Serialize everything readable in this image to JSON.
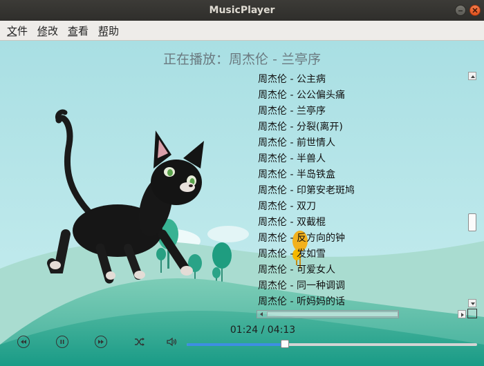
{
  "window": {
    "title": "MusicPlayer"
  },
  "menu": [
    {
      "label": "文件",
      "name": "menu-file"
    },
    {
      "label": "修改",
      "name": "menu-edit"
    },
    {
      "label": "查看",
      "name": "menu-view"
    },
    {
      "label": "帮助",
      "name": "menu-help"
    }
  ],
  "now_playing": "正在播放：周杰伦 - 兰亭序",
  "playlist": [
    "周杰伦 - 公主病",
    "周杰伦 - 公公偏头痛",
    "周杰伦 - 兰亭序",
    "周杰伦 - 分裂(离开)",
    "周杰伦 - 前世情人",
    "周杰伦 - 半兽人",
    "周杰伦 - 半岛铁盒",
    "周杰伦 - 印第安老斑鸠",
    "周杰伦 - 双刀",
    "周杰伦 - 双截棍",
    "周杰伦 - 反方向的钟",
    "周杰伦 - 发如雪",
    "周杰伦 - 可爱女人",
    "周杰伦 - 同一种调调",
    "周杰伦 - 听妈妈的话"
  ],
  "time": {
    "current": "01:24",
    "total": "04:13",
    "display": "01:24 / 04:13"
  },
  "progress": 0.337,
  "controls": {
    "prev_icon": "skip-back-icon",
    "pause_icon": "pause-icon",
    "next_icon": "skip-forward-icon",
    "shuffle_icon": "shuffle-icon",
    "volume_icon": "volume-icon"
  },
  "colors": {
    "accent": "#3d8ee3",
    "titlebar": "#3c3b37",
    "close_button": "#e95420"
  }
}
